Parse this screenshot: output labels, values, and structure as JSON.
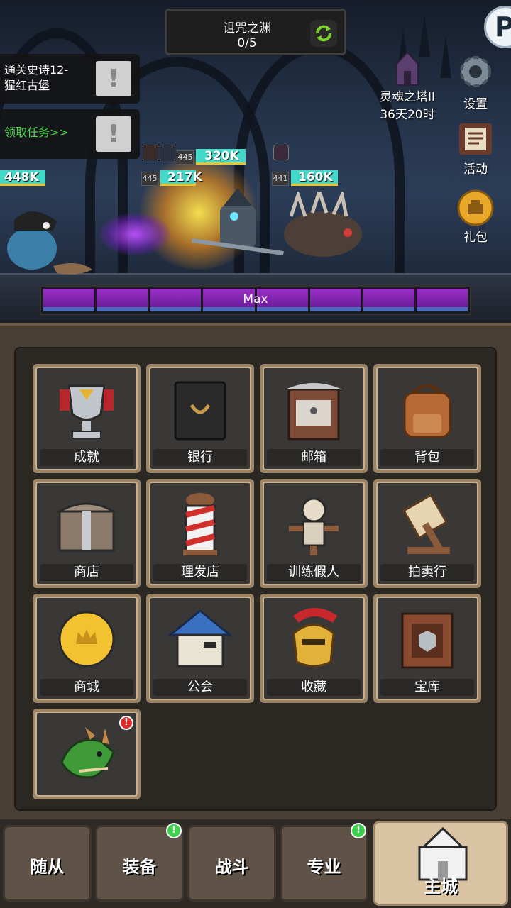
{
  "quest": {
    "title": "诅咒之渊",
    "progress": "0/5",
    "refresh_icon": "refresh-icon"
  },
  "tasks": [
    {
      "text": "通关史诗12-\n猩红古堡",
      "text_color": "#ffffff"
    },
    {
      "text": "领取任务>>",
      "text_color": "#4bd44b"
    }
  ],
  "side": {
    "tower_name": "灵魂之塔II",
    "tower_time": "36天20时",
    "settings_label": "设置",
    "events_label": "活动",
    "gift_label": "礼包",
    "corner_letter": "P"
  },
  "battle": {
    "left_hp": "448K",
    "ally_top_level": "445",
    "ally_top_hp": "320K",
    "ally_low_level": "445",
    "ally_low_hp": "217K",
    "enemy_level": "441",
    "enemy_hp": "160K",
    "energy_label": "Max"
  },
  "menu": [
    {
      "label": "成就",
      "icon": "trophy-icon"
    },
    {
      "label": "银行",
      "icon": "safe-icon"
    },
    {
      "label": "邮箱",
      "icon": "mailbox-icon"
    },
    {
      "label": "背包",
      "icon": "backpack-icon"
    },
    {
      "label": "商店",
      "icon": "chest-icon"
    },
    {
      "label": "理发店",
      "icon": "barber-pole-icon"
    },
    {
      "label": "训练假人",
      "icon": "training-dummy-icon"
    },
    {
      "label": "拍卖行",
      "icon": "gavel-icon"
    },
    {
      "label": "商城",
      "icon": "gold-coin-icon"
    },
    {
      "label": "公会",
      "icon": "guild-house-icon"
    },
    {
      "label": "收藏",
      "icon": "helmet-icon"
    },
    {
      "label": "宝库",
      "icon": "vault-crate-icon"
    },
    {
      "label": "",
      "icon": "dragon-icon",
      "alert": "!"
    }
  ],
  "tabs": [
    {
      "label": "随从",
      "badge": ""
    },
    {
      "label": "装备",
      "badge": "!"
    },
    {
      "label": "战斗",
      "badge": ""
    },
    {
      "label": "专业",
      "badge": "!"
    },
    {
      "label": "主城",
      "badge": ""
    }
  ],
  "colors": {
    "hp_teal": "#43d8c8",
    "energy_purple": "#8a2bbf",
    "frame_tan": "#9b8467"
  }
}
